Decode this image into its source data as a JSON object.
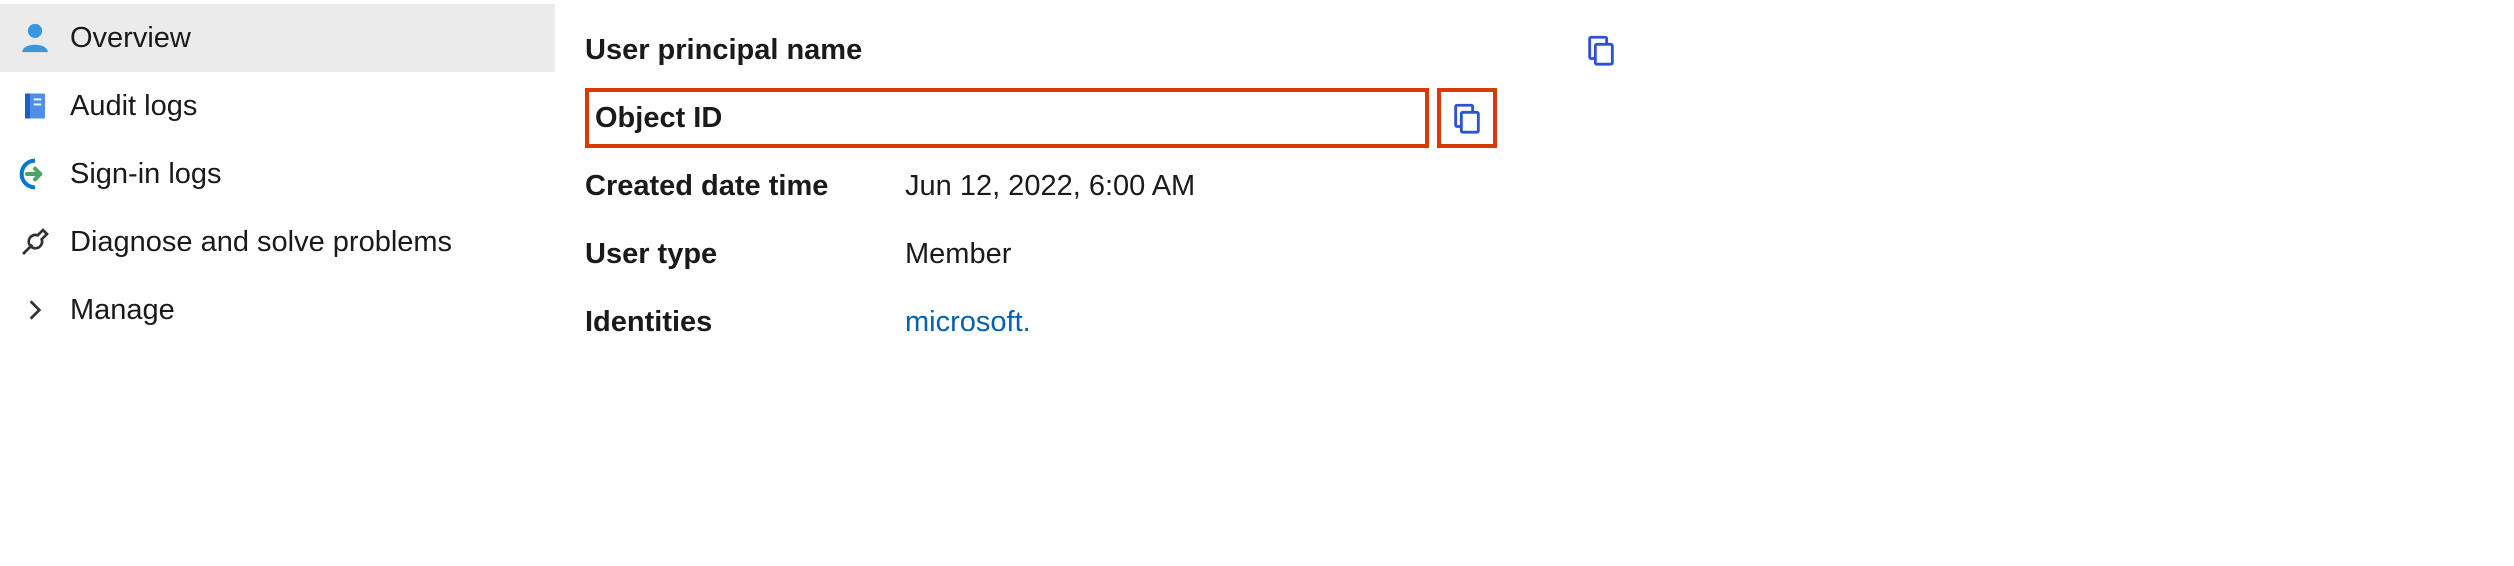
{
  "sidebar": {
    "items": [
      {
        "label": "Overview",
        "icon": "person-icon",
        "active": true
      },
      {
        "label": "Audit logs",
        "icon": "notebook-icon",
        "active": false
      },
      {
        "label": "Sign-in logs",
        "icon": "signin-icon",
        "active": false
      },
      {
        "label": "Diagnose and solve problems",
        "icon": "wrench-icon",
        "active": false
      },
      {
        "label": "Manage",
        "icon": "chevron-right-icon",
        "active": false
      }
    ]
  },
  "main": {
    "rows": [
      {
        "label": "User principal name",
        "value": "",
        "copy": true,
        "highlight": false
      },
      {
        "label": "Object ID",
        "value": "",
        "copy": true,
        "highlight": true
      },
      {
        "label": "Created date time",
        "value": "Jun 12, 2022, 6:00 AM",
        "copy": false,
        "highlight": false
      },
      {
        "label": "User type",
        "value": "Member",
        "copy": false,
        "highlight": false
      },
      {
        "label": "Identities",
        "value": "microsoft.",
        "copy": false,
        "highlight": false,
        "link": true
      }
    ]
  }
}
